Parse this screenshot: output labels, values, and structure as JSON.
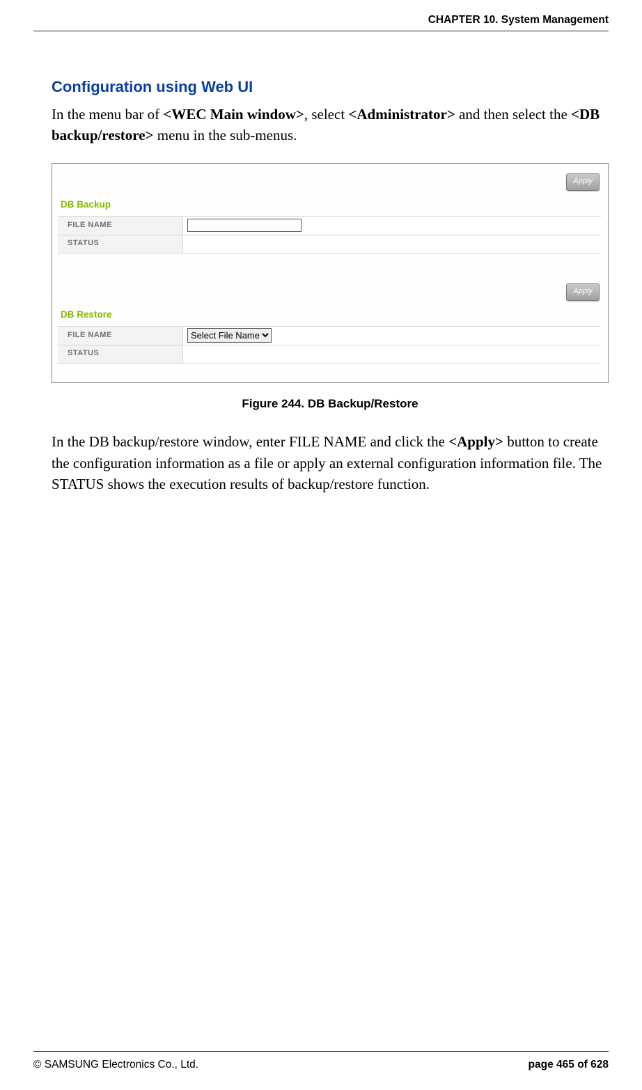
{
  "header": {
    "chapter": "CHAPTER 10. System Management"
  },
  "section": {
    "title": "Configuration using Web UI",
    "para1_prefix": "In the menu bar of ",
    "para1_b1": "<WEC Main window>",
    "para1_mid1": ", select ",
    "para1_b2": "<Administrator>",
    "para1_mid2": " and then select the ",
    "para1_b3": "<DB backup/restore>",
    "para1_suffix": " menu in the sub-menus."
  },
  "figure": {
    "apply_label": "Apply",
    "backup": {
      "title": "DB Backup",
      "file_name_label": "FILE NAME",
      "status_label": "STATUS",
      "file_name_value": "",
      "status_value": ""
    },
    "restore": {
      "title": "DB Restore",
      "file_name_label": "FILE NAME",
      "status_label": "STATUS",
      "select_option": "Select File Name",
      "status_value": ""
    },
    "caption": "Figure 244. DB Backup/Restore"
  },
  "para2": {
    "prefix": "In the DB backup/restore window, enter FILE NAME and click the ",
    "b1": "<Apply>",
    "suffix": " button to create the configuration information as a file or apply an external configuration information file. The STATUS shows the execution results of backup/restore function."
  },
  "footer": {
    "copyright": "© SAMSUNG Electronics Co., Ltd.",
    "page": "page 465 of 628"
  }
}
